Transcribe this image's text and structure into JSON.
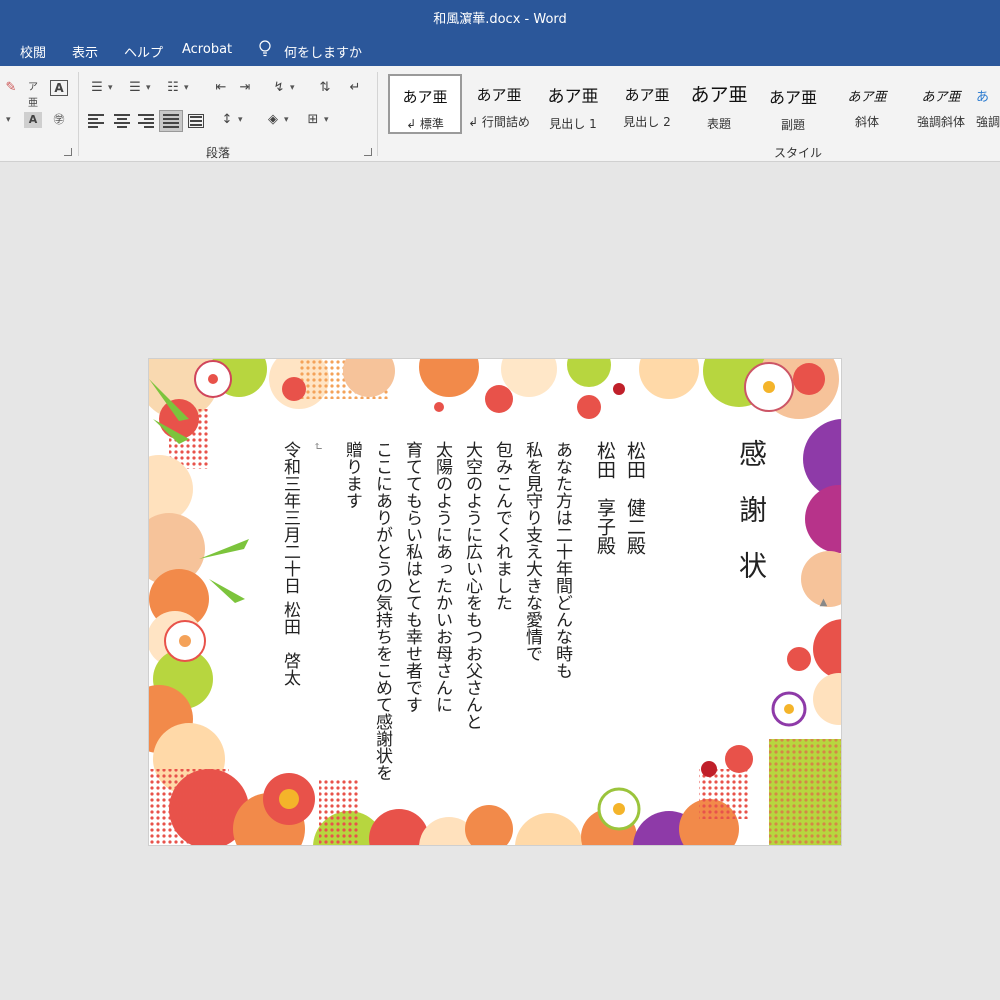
{
  "window": {
    "title": "和風濵華.docx  -  Word"
  },
  "menu": {
    "tabs": [
      "校閲",
      "表示",
      "ヘルプ",
      "Acrobat"
    ],
    "tell_me": "何をしますか"
  },
  "ribbon": {
    "groups": {
      "paragraph": "段落",
      "styles": "スタイル"
    },
    "styles": [
      {
        "sample": "あア亜",
        "name": "↲ 標準"
      },
      {
        "sample": "あア亜",
        "name": "↲ 行間詰め"
      },
      {
        "sample": "あア亜",
        "name": "見出し 1"
      },
      {
        "sample": "あア亜",
        "name": "見出し 2"
      },
      {
        "sample": "あア亜",
        "name": "表題"
      },
      {
        "sample": "あア亜",
        "name": "副題"
      },
      {
        "sample": "あア亜",
        "name": "斜体"
      },
      {
        "sample": "あア亜",
        "name": "強調斜体"
      },
      {
        "sample": "あ",
        "name": "強調"
      }
    ]
  },
  "document": {
    "title": "感　謝　状",
    "recipient1": "松田　健二殿",
    "recipient2": "松田　享子殿",
    "body": [
      "あなた方は二十年間どんな時も",
      "私を見守り支え大きな愛情で",
      "包みこんでくれました",
      "大空のように広い心をもつお父さんと",
      "太陽のようにあったかいお母さんに",
      "育ててもらい私はとても幸せ者です",
      "ここにありがとうの気持ちをこめて感謝状を",
      "贈ります"
    ],
    "date": "令和三年三月二十日",
    "sender": "松田　啓太",
    "return_mark": "↵"
  },
  "colors": {
    "titlebar": "#2b579a",
    "ribbon": "#f3f3f3",
    "canvas": "#e6e6e6"
  }
}
